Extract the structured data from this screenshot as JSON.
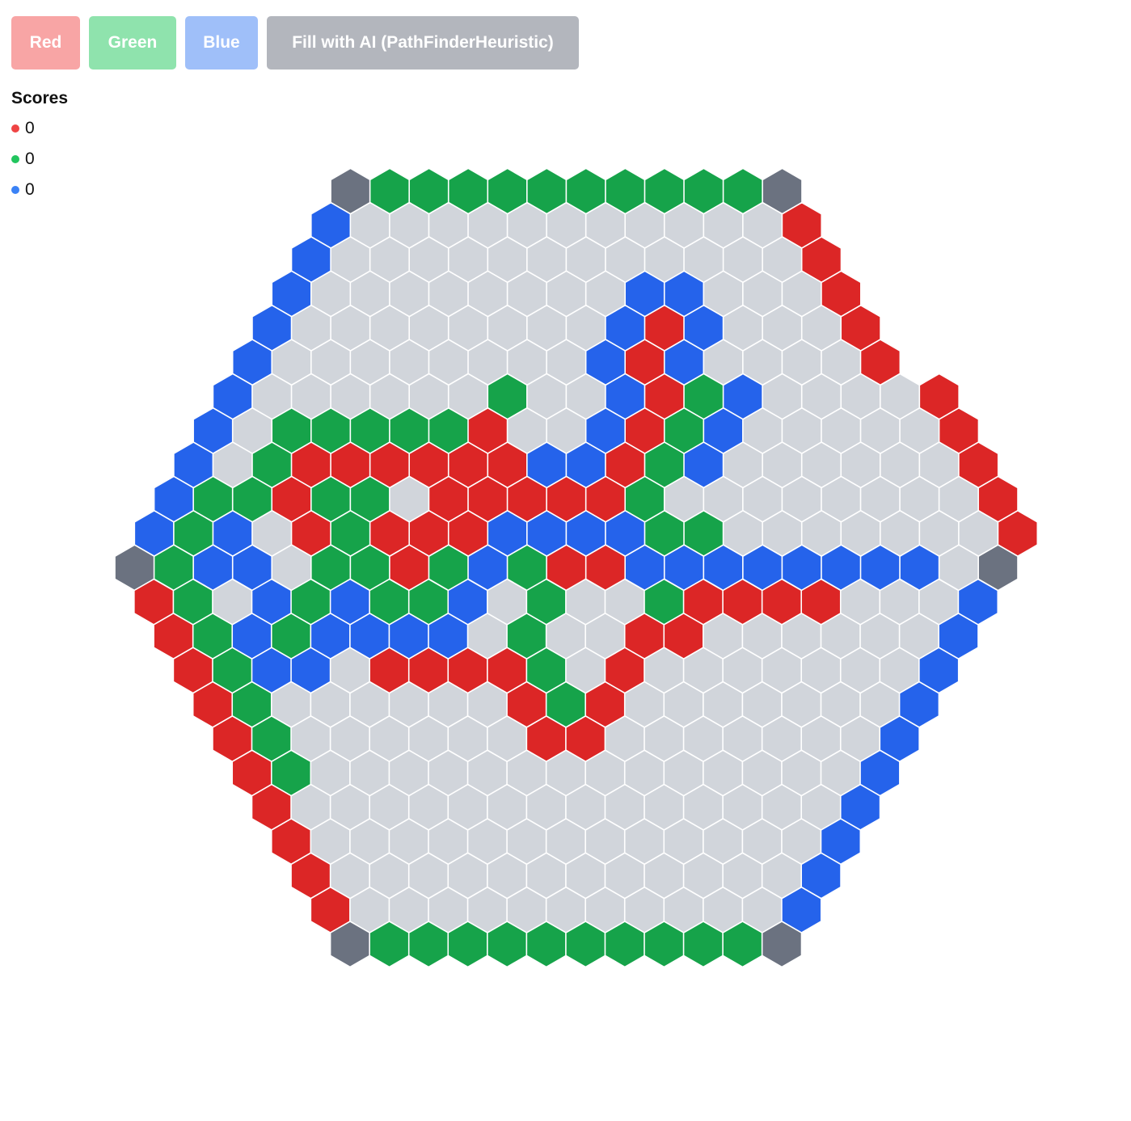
{
  "toolbar": {
    "red_label": "Red",
    "green_label": "Green",
    "blue_label": "Blue",
    "ai_label": "Fill with AI (PathFinderHeuristic)"
  },
  "scores": {
    "title": "Scores",
    "red": "0",
    "green": "0",
    "blue": "0"
  },
  "colors": {
    "red": "#dc2626",
    "green": "#16a34a",
    "blue": "#2563eb",
    "empty": "#d1d5db",
    "corner": "#6b7280",
    "grid_line": "#ffffff"
  },
  "board": {
    "legend": "E = empty, R = red, G = green, B = blue, C = corner",
    "rows": [
      "CGGGGGGGGGGC",
      "BEEEEEEEEEEER",
      "BEEEEEEEEEEEER",
      "BEEEEEEEEBBEEER",
      "BEEEEEEEEBRBEEER",
      "BEEEEEEEEBRBEEEER",
      "BEEEEEEGEEBRGBEEEER",
      "BEGGGGGREEBRGBEEEEER",
      "BEGRRRRRRBBRGBEEEEEER",
      "BGGRGGERRRRRGEEEEEEEER",
      "BGBERGRRRBBBBGGEEEEEEER",
      "CGBBEGGRGBGRRBBBBBBBBEC",
      "RGEBGBGGBEGEEGRRRREEEB",
      "RGBGBBBBEGEERREEEEEEB",
      "RGBBERRRRGEREEEEEEEB",
      "RGEEEEEERGREEEEEEEB",
      "RGEEEEEERREEEEEEEB",
      "RGEEEEEEEEEEEEEEB",
      "REEEEEEEEEEEEEEB",
      "REEEEEEEEEEEEEB",
      "REEEEEEEEEEEEB",
      "REEEEEEEEEEEB",
      "CGGGGGGGGGGC"
    ]
  }
}
